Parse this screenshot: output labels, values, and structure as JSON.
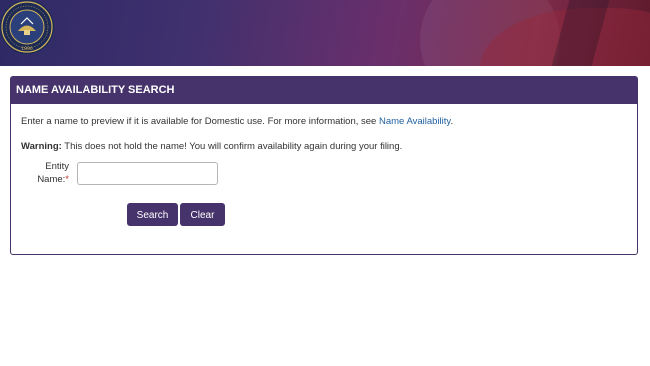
{
  "banner": {
    "seal_icon": "utah-state-seal-icon",
    "seal_year": "1896"
  },
  "panel": {
    "title": "NAME AVAILABILITY SEARCH",
    "intro_text": "Enter a name to preview if it is available for Domestic use. For more information, see ",
    "intro_link": "Name Availability",
    "intro_end": ".",
    "warning_label": "Warning:",
    "warning_text": " This does not hold the name! You will confirm availability again during your filing.",
    "field_label_line1": "Entity",
    "field_label_line2": "Name:",
    "required_mark": "*",
    "field_value": "",
    "search_label": "Search",
    "clear_label": "Clear"
  },
  "colors": {
    "accent": "#47336b",
    "link": "#1f5f9e",
    "required": "#c0392b"
  }
}
